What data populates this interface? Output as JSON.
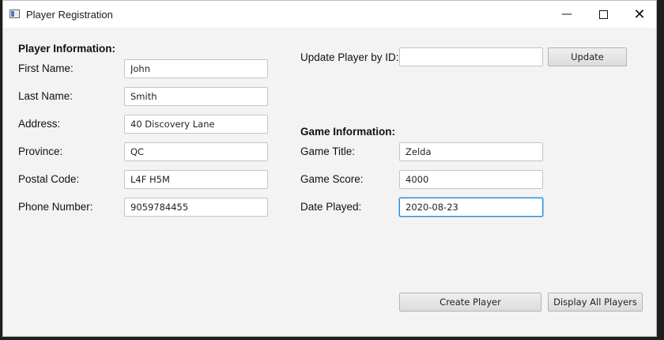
{
  "window": {
    "title": "Player Registration"
  },
  "player": {
    "heading": "Player Information:",
    "first_name_label": "First Name:",
    "first_name": "John",
    "last_name_label": "Last Name:",
    "last_name": "Smith",
    "address_label": "Address:",
    "address": "40 Discovery Lane",
    "province_label": "Province:",
    "province": "QC",
    "postal_label": "Postal Code:",
    "postal": "L4F H5M",
    "phone_label": "Phone Number:",
    "phone": "9059784455"
  },
  "update": {
    "label": "Update Player by ID:",
    "value": "",
    "button": "Update"
  },
  "game": {
    "heading": "Game Information:",
    "title_label": "Game Title:",
    "title": "Zelda",
    "score_label": "Game Score:",
    "score": "4000",
    "date_label": "Date Played:",
    "date": "2020-08-23"
  },
  "actions": {
    "create": "Create Player",
    "display": "Display All Players"
  },
  "icons": {
    "app": "app-window-icon",
    "minimize": "minimize-icon",
    "maximize": "maximize-icon",
    "close": "close-icon"
  },
  "colors": {
    "focus": "#2b8fd6",
    "background": "#f3f3f3"
  }
}
